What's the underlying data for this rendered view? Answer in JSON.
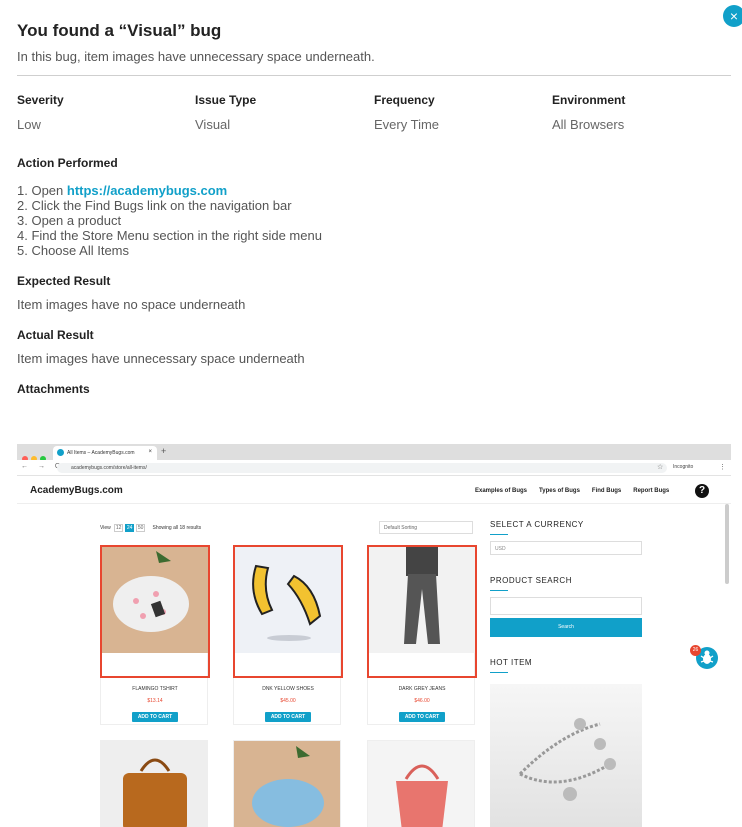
{
  "modal": {
    "title": "You found a “Visual” bug",
    "subtitle": "In this bug, item images have unnecessary space underneath.",
    "close_icon": "×"
  },
  "meta": [
    {
      "label": "Severity",
      "value": "Low"
    },
    {
      "label": "Issue Type",
      "value": "Visual"
    },
    {
      "label": "Frequency",
      "value": "Every Time"
    },
    {
      "label": "Environment",
      "value": "All Browsers"
    }
  ],
  "action": {
    "heading": "Action Performed",
    "step1_prefix": "1. Open ",
    "step1_link": "https://academybugs.com",
    "steps": [
      "2. Click the Find Bugs link on the navigation bar",
      "3. Open a product",
      "4. Find the Store Menu section in the right side menu",
      "5. Choose All Items"
    ]
  },
  "expected": {
    "heading": "Expected Result",
    "text": "Item images have no space underneath"
  },
  "actual": {
    "heading": "Actual Result",
    "text": "Item images have unnecessary space underneath"
  },
  "attachments": {
    "heading": "Attachments"
  },
  "screenshot": {
    "tab_title": "All Items – AcademyBugs.com",
    "tab_close": "×",
    "new_tab": "+",
    "nav_buttons": "← → C",
    "url": "academybugs.com/store/all-items/",
    "star": "☆",
    "incognito": "Incognito",
    "kebab": "⋮",
    "logo": "AcademyBugs.com",
    "nav": [
      "Examples of Bugs",
      "Types of Bugs",
      "Find Bugs",
      "Report Bugs"
    ],
    "help": "?",
    "view_label": "View",
    "pages": [
      "12",
      "24",
      "50"
    ],
    "results": "Showing all 18 results",
    "sort": "Default Sorting",
    "products": [
      {
        "name": "FLAMINGO TSHIRT",
        "price": "$13.14",
        "button": "ADD TO CART"
      },
      {
        "name": "DNK YELLOW SHOES",
        "price": "$45.00",
        "button": "ADD TO CART"
      },
      {
        "name": "DARK GREY JEANS",
        "price": "$46.00",
        "button": "ADD TO CART"
      }
    ],
    "currency_heading": "SELECT A CURRENCY",
    "currency_value": "USD",
    "search_heading": "PRODUCT SEARCH",
    "search_button": "Search",
    "hot_heading": "HOT ITEM",
    "bug_count": "26"
  },
  "colors": {
    "accent": "#11a0c9",
    "highlight": "#e8462f"
  }
}
